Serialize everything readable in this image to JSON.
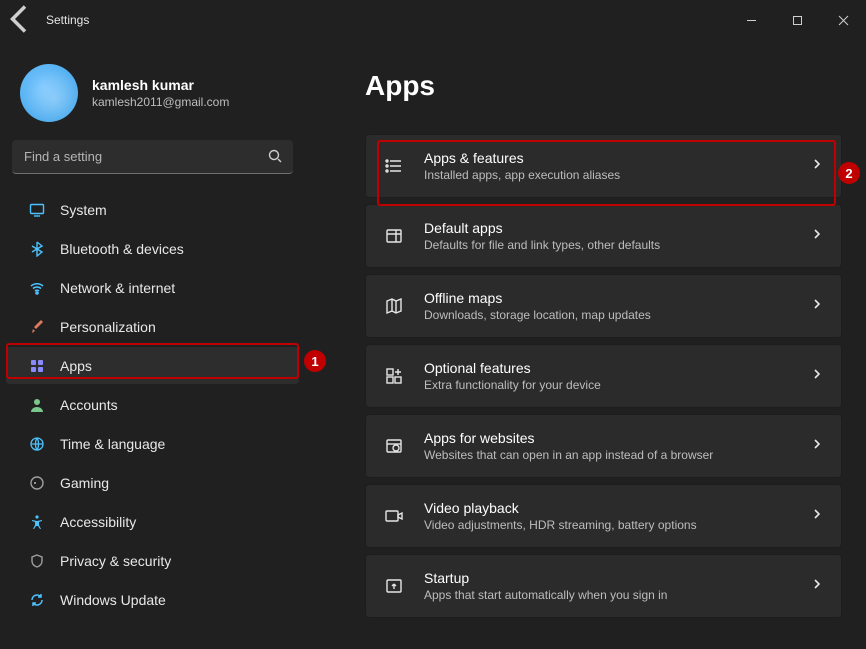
{
  "window": {
    "title": "Settings"
  },
  "profile": {
    "name": "kamlesh kumar",
    "email": "kamlesh2011@gmail.com"
  },
  "search": {
    "placeholder": "Find a setting"
  },
  "sidebar": {
    "items": [
      {
        "label": "System"
      },
      {
        "label": "Bluetooth & devices"
      },
      {
        "label": "Network & internet"
      },
      {
        "label": "Personalization"
      },
      {
        "label": "Apps"
      },
      {
        "label": "Accounts"
      },
      {
        "label": "Time & language"
      },
      {
        "label": "Gaming"
      },
      {
        "label": "Accessibility"
      },
      {
        "label": "Privacy & security"
      },
      {
        "label": "Windows Update"
      }
    ],
    "selected_index": 4
  },
  "page": {
    "title": "Apps"
  },
  "cards": [
    {
      "title": "Apps & features",
      "desc": "Installed apps, app execution aliases"
    },
    {
      "title": "Default apps",
      "desc": "Defaults for file and link types, other defaults"
    },
    {
      "title": "Offline maps",
      "desc": "Downloads, storage location, map updates"
    },
    {
      "title": "Optional features",
      "desc": "Extra functionality for your device"
    },
    {
      "title": "Apps for websites",
      "desc": "Websites that can open in an app instead of a browser"
    },
    {
      "title": "Video playback",
      "desc": "Video adjustments, HDR streaming, battery options"
    },
    {
      "title": "Startup",
      "desc": "Apps that start automatically when you sign in"
    }
  ],
  "annotations": {
    "sidebar_badge": "1",
    "card_badge": "2"
  }
}
